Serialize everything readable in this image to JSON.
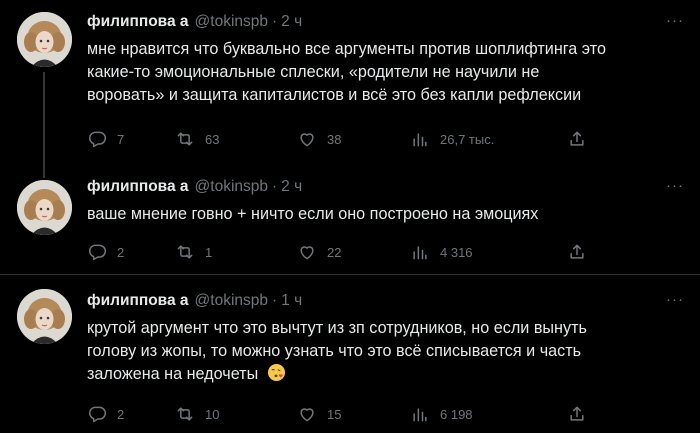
{
  "tweets": [
    {
      "name": "филиппова а",
      "handle": "@tokinspb",
      "dot": "·",
      "time": "2 ч",
      "more": "···",
      "text_lines": [
        "мне нравится что буквально все аргументы против шоплифтинга это",
        "какие-то эмоциональные сплески, «родители не научили не",
        "воровать» и защита капиталистов и всё это без капли рефлексии"
      ],
      "replies": "7",
      "retweets": "63",
      "likes": "38",
      "views": "26,7 тыс."
    },
    {
      "name": "филиппова а",
      "handle": "@tokinspb",
      "dot": "·",
      "time": "2 ч",
      "more": "···",
      "text_lines": [
        "ваше мнение говно + ничто если оно построено на эмоциях"
      ],
      "replies": "2",
      "retweets": "1",
      "likes": "22",
      "views": "4 316"
    },
    {
      "name": "филиппова а",
      "handle": "@tokinspb",
      "dot": "·",
      "time": "1 ч",
      "more": "···",
      "text_lines": [
        "крутой аргумент что это вычтут из зп сотрудников, но если вынуть",
        "голову из жопы, то можно узнать что это всё списывается и часть",
        "заложена на недочеты"
      ],
      "emoji": "face-blowing-kiss-icon",
      "replies": "2",
      "retweets": "10",
      "likes": "15",
      "views": "6 198"
    }
  ],
  "colors": {
    "background": "#000000",
    "text": "#e7e9ea",
    "muted": "#71767b",
    "divider": "#2f3336"
  }
}
